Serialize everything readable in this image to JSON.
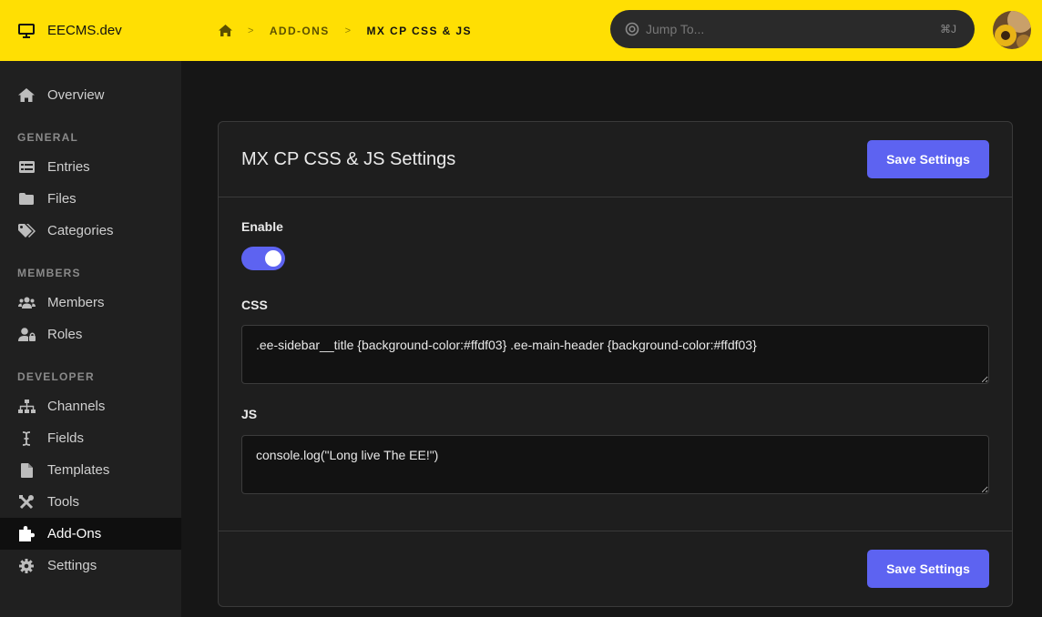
{
  "header": {
    "site_name": "EECMS.dev",
    "breadcrumb": {
      "separator": ">",
      "items": [
        "ADD-ONS"
      ],
      "current": "MX CP CSS & JS"
    },
    "jump": {
      "placeholder": "Jump To...",
      "shortcut": "⌘J"
    },
    "accent_color": "#ffdf03"
  },
  "sidebar": {
    "overview": "Overview",
    "sections": {
      "general": "GENERAL",
      "members": "MEMBERS",
      "developer": "DEVELOPER"
    },
    "items": {
      "entries": "Entries",
      "files": "Files",
      "categories": "Categories",
      "members": "Members",
      "roles": "Roles",
      "channels": "Channels",
      "fields": "Fields",
      "templates": "Templates",
      "tools": "Tools",
      "addons": "Add-Ons",
      "settings": "Settings"
    },
    "active_item": "Add-Ons"
  },
  "panel": {
    "title": "MX CP CSS & JS Settings",
    "save_label": "Save Settings",
    "enable_label": "Enable",
    "enable_value": true,
    "css_label": "CSS",
    "css_value": ".ee-sidebar__title {background-color:#ffdf03} .ee-main-header {background-color:#ffdf03}",
    "js_label": "JS",
    "js_value": "console.log(\"Long live The EE!\")",
    "button_color": "#5d63f1"
  }
}
